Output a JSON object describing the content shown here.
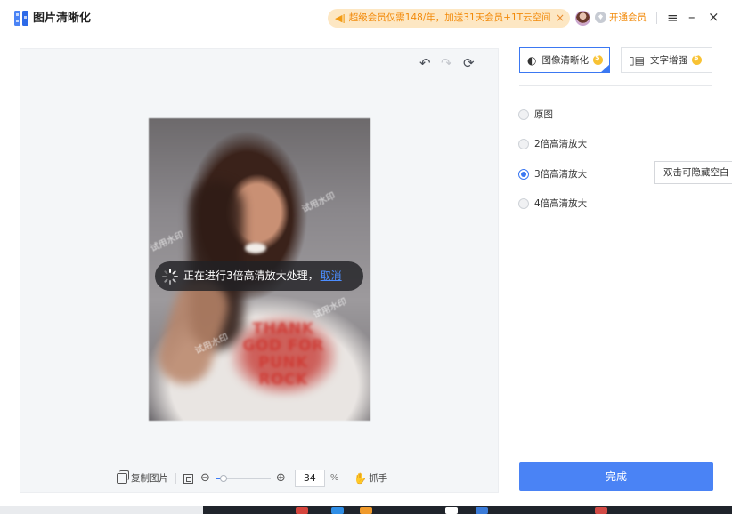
{
  "app": {
    "title": "图片清晰化"
  },
  "topbar": {
    "promo_text": "超级会员仅需148/年，加送31天会员+1T云空间",
    "promo_close": "×",
    "vip_label": "开通会员",
    "menu_icon": "hamburger-icon",
    "minimize": "–",
    "close": "×"
  },
  "preview": {
    "undo_icon": "↶",
    "redo_icon": "↷",
    "reset_icon": "⟳",
    "shirt_text": "THANK\nGOD FOR\nPUNK\nROCK",
    "watermark": "试用水印",
    "progress_text": "正在进行3倍高清放大处理，",
    "progress_cancel": "取消"
  },
  "bottom_toolbar": {
    "copy_label": "复制图片",
    "zoom_out": "⊖",
    "zoom_in": "⊕",
    "zoom_value": "34",
    "zoom_unit": "%",
    "hand_icon": "✋",
    "hand_label": "抓手",
    "zoom_fraction": 0.15
  },
  "right_panel": {
    "tabs": [
      {
        "label": "图像清晰化",
        "icon": "aperture-icon",
        "active": true
      },
      {
        "label": "文字增强",
        "icon": "book-icon",
        "active": false
      }
    ],
    "options": [
      {
        "label": "原图",
        "checked": false
      },
      {
        "label": "2倍高清放大",
        "checked": false
      },
      {
        "label": "3倍高清放大",
        "checked": true
      },
      {
        "label": "4倍高清放大",
        "checked": false
      }
    ],
    "tooltip": "双击可隐藏空白",
    "done_label": "完成"
  },
  "colors": {
    "accent": "#4a83f5",
    "promo_bg": "#fde7c3",
    "promo_text": "#f28a0a"
  }
}
